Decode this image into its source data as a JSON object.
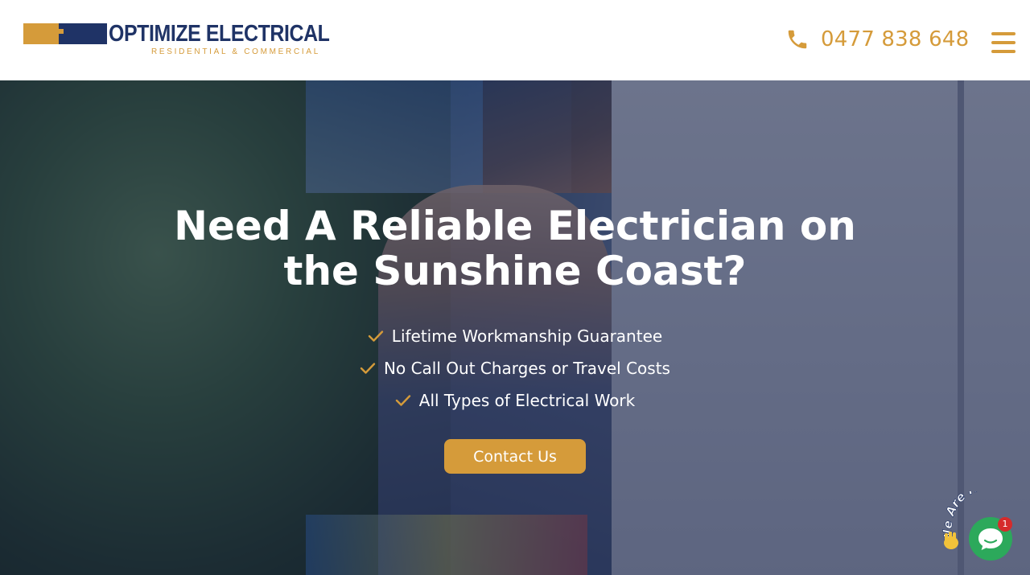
{
  "brand": {
    "name": "OPTIMIZE ELECTRICAL",
    "tagline": "RESIDENTIAL & COMMERCIAL"
  },
  "header": {
    "phone": "0477 838 648",
    "phone_icon": "phone-icon",
    "menu_icon": "hamburger-menu-icon"
  },
  "hero": {
    "title_line1": "Need A Reliable Electrician on",
    "title_line2": "the Sunshine Coast?",
    "features": [
      "Lifetime Workmanship Guarantee",
      "No Call Out Charges or Travel Costs",
      "All Types of Electrical Work"
    ],
    "cta_label": "Contact Us"
  },
  "chat_widget": {
    "greeting": "We Are Here!",
    "badge_count": "1",
    "icon": "chat-bubble-icon"
  },
  "colors": {
    "accent": "#d59b3a",
    "brand_navy": "#1f3366",
    "chat_green": "#2ca95b",
    "badge_red": "#d62b2b"
  }
}
